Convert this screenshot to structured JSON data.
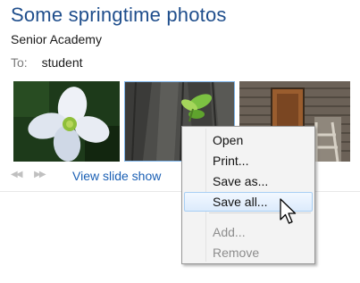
{
  "message": {
    "subject": "Some springtime photos",
    "sender": "Senior Academy",
    "to_label": "To:",
    "to_value": "student"
  },
  "photos": [
    {
      "name": "white-dogwood-flower-photo"
    },
    {
      "name": "tree-bark-sprout-photo"
    },
    {
      "name": "wooden-cabin-photo"
    }
  ],
  "controls": {
    "prev_icon": "◀◀",
    "next_icon": "▶▶",
    "slide_show": "View slide show"
  },
  "context_menu": {
    "items": [
      {
        "label": "Open",
        "enabled": true
      },
      {
        "label": "Print...",
        "enabled": true
      },
      {
        "label": "Save as...",
        "enabled": true
      },
      {
        "label": "Save all...",
        "enabled": true,
        "highlighted": true
      },
      {
        "label": "Add...",
        "enabled": false
      },
      {
        "label": "Remove",
        "enabled": false
      }
    ]
  },
  "colors": {
    "title": "#1f4e8c",
    "link": "#1a5fb4",
    "selection_border": "#7eb4ea"
  }
}
